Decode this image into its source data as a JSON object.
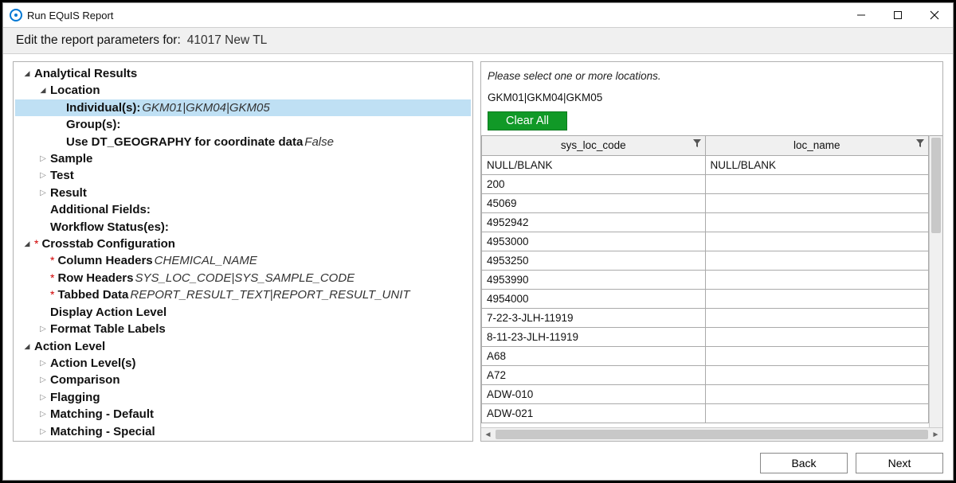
{
  "window_title": "Run EQuIS Report",
  "subheader_label": "Edit the report parameters for:",
  "report_name": "41017 New TL",
  "tree": [
    {
      "indent": 0,
      "caret": "open",
      "star": false,
      "bold": true,
      "label": "Analytical Results"
    },
    {
      "indent": 1,
      "caret": "open",
      "star": false,
      "bold": true,
      "label": "Location"
    },
    {
      "indent": 2,
      "caret": "none",
      "star": false,
      "bold": true,
      "label": "Individual(s): ",
      "value": "GKM01|GKM04|GKM05",
      "selected": true
    },
    {
      "indent": 2,
      "caret": "none",
      "star": false,
      "bold": true,
      "label": "Group(s):"
    },
    {
      "indent": 2,
      "caret": "none",
      "star": false,
      "bold": true,
      "label": "Use DT_GEOGRAPHY for coordinate data ",
      "value": "False"
    },
    {
      "indent": 1,
      "caret": "closed",
      "star": false,
      "bold": true,
      "label": "Sample"
    },
    {
      "indent": 1,
      "caret": "closed",
      "star": false,
      "bold": true,
      "label": "Test"
    },
    {
      "indent": 1,
      "caret": "closed",
      "star": false,
      "bold": true,
      "label": "Result"
    },
    {
      "indent": 1,
      "caret": "none",
      "star": false,
      "bold": true,
      "label": "Additional Fields:"
    },
    {
      "indent": 1,
      "caret": "none",
      "star": false,
      "bold": true,
      "label": "Workflow Status(es):"
    },
    {
      "indent": 0,
      "caret": "open",
      "star": true,
      "bold": true,
      "label": "Crosstab Configuration"
    },
    {
      "indent": 1,
      "caret": "none",
      "star": true,
      "bold": true,
      "label": "Column Headers ",
      "value": "CHEMICAL_NAME"
    },
    {
      "indent": 1,
      "caret": "none",
      "star": true,
      "bold": true,
      "label": "Row Headers ",
      "value": "SYS_LOC_CODE|SYS_SAMPLE_CODE"
    },
    {
      "indent": 1,
      "caret": "none",
      "star": true,
      "bold": true,
      "label": "Tabbed Data ",
      "value": "REPORT_RESULT_TEXT|REPORT_RESULT_UNIT"
    },
    {
      "indent": 1,
      "caret": "none",
      "star": false,
      "bold": true,
      "label": "Display Action Level"
    },
    {
      "indent": 1,
      "caret": "closed",
      "star": false,
      "bold": true,
      "label": "Format Table Labels"
    },
    {
      "indent": 0,
      "caret": "open",
      "star": false,
      "bold": true,
      "label": "Action Level"
    },
    {
      "indent": 1,
      "caret": "closed",
      "star": false,
      "bold": true,
      "label": "Action Level(s)"
    },
    {
      "indent": 1,
      "caret": "closed",
      "star": false,
      "bold": true,
      "label": "Comparison"
    },
    {
      "indent": 1,
      "caret": "closed",
      "star": false,
      "bold": true,
      "label": "Flagging"
    },
    {
      "indent": 1,
      "caret": "closed",
      "star": false,
      "bold": true,
      "label": "Matching - Default"
    },
    {
      "indent": 1,
      "caret": "closed",
      "star": false,
      "bold": true,
      "label": "Matching - Special"
    }
  ],
  "right": {
    "instruction": "Please select one or more locations.",
    "selection": "GKM01|GKM04|GKM05",
    "clear_button": "Clear All",
    "columns": [
      "sys_loc_code",
      "loc_name"
    ],
    "rows": [
      {
        "sys_loc_code": "NULL/BLANK",
        "loc_name": "NULL/BLANK"
      },
      {
        "sys_loc_code": "200",
        "loc_name": ""
      },
      {
        "sys_loc_code": "45069",
        "loc_name": ""
      },
      {
        "sys_loc_code": "4952942",
        "loc_name": ""
      },
      {
        "sys_loc_code": "4953000",
        "loc_name": ""
      },
      {
        "sys_loc_code": "4953250",
        "loc_name": ""
      },
      {
        "sys_loc_code": "4953990",
        "loc_name": ""
      },
      {
        "sys_loc_code": "4954000",
        "loc_name": ""
      },
      {
        "sys_loc_code": "7-22-3-JLH-11919",
        "loc_name": ""
      },
      {
        "sys_loc_code": "8-11-23-JLH-11919",
        "loc_name": ""
      },
      {
        "sys_loc_code": "A68",
        "loc_name": ""
      },
      {
        "sys_loc_code": "A72",
        "loc_name": ""
      },
      {
        "sys_loc_code": "ADW-010",
        "loc_name": ""
      },
      {
        "sys_loc_code": "ADW-021",
        "loc_name": ""
      }
    ]
  },
  "footer": {
    "back": "Back",
    "next": "Next"
  }
}
